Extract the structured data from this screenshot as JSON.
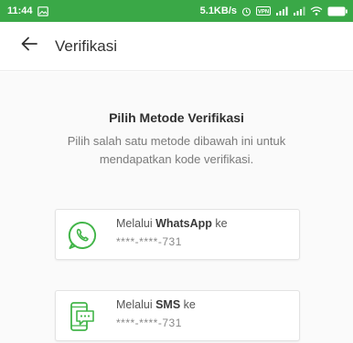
{
  "status_bar": {
    "time": "11:44",
    "network_speed": "5.1KB/s",
    "vpn_label": "VPN",
    "icons": [
      "gallery-icon",
      "alarm-icon",
      "vpn-icon",
      "signal-icon",
      "signal-icon",
      "wifi-icon",
      "battery-icon"
    ]
  },
  "app_bar": {
    "back_icon": "arrow-left-icon",
    "title": "Verifikasi"
  },
  "main": {
    "heading": "Pilih Metode Verifikasi",
    "subtitle": "Pilih salah satu metode dibawah ini untuk mendapatkan kode verifikasi."
  },
  "methods": [
    {
      "icon": "whatsapp-icon",
      "prefix": "Melalui ",
      "channel": "WhatsApp",
      "suffix": " ke",
      "masked_number": "****-****-731"
    },
    {
      "icon": "sms-icon",
      "prefix": "Melalui ",
      "channel": "SMS",
      "suffix": " ke",
      "masked_number": "****-****-731"
    }
  ],
  "colors": {
    "status_bar": "#3aa847",
    "accent_green": "#42b549",
    "background": "#fafafa"
  }
}
